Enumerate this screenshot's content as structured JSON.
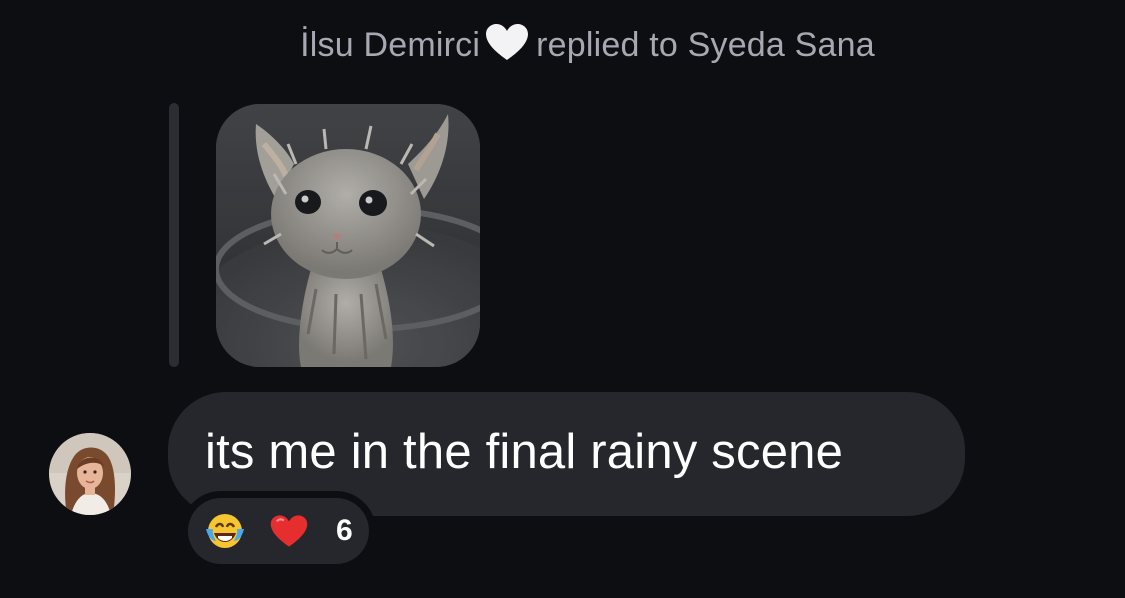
{
  "header": {
    "sender": "İlsu Demirci",
    "action": "replied to",
    "recipient": "Syeda Sana",
    "icon": "white-heart-icon"
  },
  "quoted_message": {
    "icon": "wet-kitten-photo"
  },
  "message": {
    "text": "its me in the final rainy scene",
    "avatar_icon": "profile-photo-avatar"
  },
  "reactions": {
    "emojis": [
      "laughing-tears-emoji-icon",
      "red-heart-icon"
    ],
    "count": "6"
  },
  "colors": {
    "background": "#0d0e12",
    "bubble": "#25272c",
    "header_text": "#a6a8b2",
    "message_text": "#ffffff",
    "quote_bar": "#2c2d33"
  }
}
